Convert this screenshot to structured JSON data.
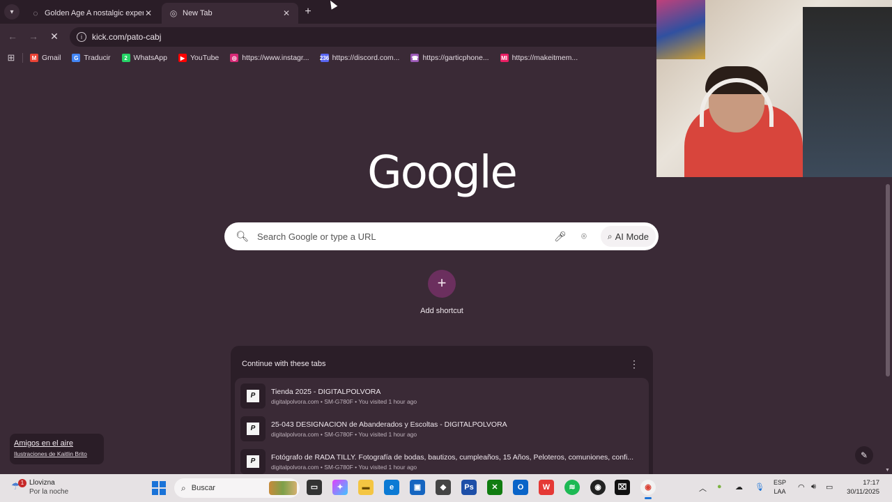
{
  "tabs": {
    "items": [
      {
        "title": "Golden Age A nostalgic experie",
        "icon": "loading-spinner-icon",
        "active": false
      },
      {
        "title": "New Tab",
        "icon": "chrome-newtab-icon",
        "active": true
      }
    ],
    "new_tab": "+",
    "close_glyph": "✕"
  },
  "toolbar": {
    "url": "kick.com/pato-cabj"
  },
  "bookmarks": [
    {
      "label": "Gmail",
      "icon": "gmail-icon",
      "color": "#ea4335",
      "glyph": "M"
    },
    {
      "label": "Traducir",
      "icon": "translate-icon",
      "color": "#4285f4",
      "glyph": "G"
    },
    {
      "label": "WhatsApp",
      "icon": "whatsapp-icon",
      "color": "#25d366",
      "glyph": "2"
    },
    {
      "label": "YouTube",
      "icon": "youtube-icon",
      "color": "#ff0000",
      "glyph": "▶"
    },
    {
      "label": "https://www.instagr...",
      "icon": "instagram-icon",
      "color": "#d62976",
      "glyph": "◎"
    },
    {
      "label": "https://discord.com...",
      "icon": "discord-icon",
      "color": "#5865f2",
      "glyph": "236"
    },
    {
      "label": "https://garticphone...",
      "icon": "garticphone-icon",
      "color": "#9b59b6",
      "glyph": "☎"
    },
    {
      "label": "https://makeitmem...",
      "icon": "makeitmeme-icon",
      "color": "#e91e63",
      "glyph": "MI"
    }
  ],
  "main": {
    "logo": "Google",
    "search_placeholder": "Search Google or type a URL",
    "ai_mode": "AI Mode",
    "add_shortcut": "Add shortcut"
  },
  "continue": {
    "header": "Continue with these tabs",
    "items": [
      {
        "title": "Tienda 2025 - DIGITALPOLVORA",
        "subtitle": "digitalpolvora.com • SM-G780F • You visited 1 hour ago"
      },
      {
        "title": "25-043 DESIGNACION de Abanderados y Escoltas - DIGITALPOLVORA",
        "subtitle": "digitalpolvora.com • SM-G780F • You visited 1 hour ago"
      },
      {
        "title": "Fotógrafo de RADA TILLY. Fotografía de bodas, bautizos, cumpleaños, 15 Años, Peloteros, comuniones, confi...",
        "subtitle": "digitalpolvora.com • SM-G780F • You visited 1 hour ago"
      }
    ]
  },
  "notification": {
    "title": "Amigos en el aire",
    "subtitle": "Ilustraciones de Kaitlin Brito"
  },
  "taskbar": {
    "weather_title": "Llovizna",
    "weather_sub": "Por la noche",
    "weather_badge": "1",
    "search": "Buscar",
    "lang_top": "ESP",
    "lang_bottom": "LAA",
    "time": "17:17",
    "date": "30/11/2025"
  }
}
